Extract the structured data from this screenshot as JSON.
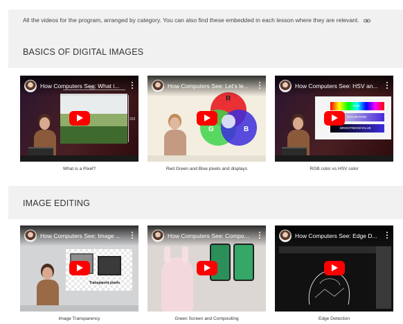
{
  "intro": {
    "text": "All the videos for the program, arranged by category. You can also find these embedded in each lesson where they are relevant.",
    "link_icon": "link-icon"
  },
  "sections": [
    {
      "heading": "BASICS OF DIGITAL IMAGES",
      "videos": [
        {
          "title": "How Computers See: What i...",
          "caption": "What is a Pixel?",
          "labels": {
            "width": "500",
            "height": "333"
          }
        },
        {
          "title": "How Computers See: Let's le...",
          "caption": "Red Green and Blue pixels and displays",
          "labels": {
            "r": "R",
            "g": "G",
            "b": "B"
          }
        },
        {
          "title": "How Computers See: HSV an...",
          "caption": "RGB color vs HSV color",
          "labels": {
            "hue": "HUE",
            "saturation": "SATURATION",
            "brightness": "BRIGHTNESS/VALUE"
          }
        }
      ]
    },
    {
      "heading": "IMAGE EDITING",
      "videos": [
        {
          "title": "How Computers See: Image ...",
          "caption": "Image Transparency",
          "labels": {
            "transparent": "Transparent pixels"
          }
        },
        {
          "title": "How Computers See: Compo...",
          "caption": "Green Screen and Compositing"
        },
        {
          "title": "How Computers See: Edge D...",
          "caption": "Edge Detection"
        }
      ]
    }
  ],
  "colors": {
    "panel_bg": "#f1f1f1",
    "play_button": "#ff0000",
    "red": "#e8262b",
    "green": "#3dd44a",
    "blue": "#3b2ddc"
  },
  "icons": [
    "link-icon",
    "avatar-icon",
    "play-icon",
    "kebab-menu-icon"
  ]
}
